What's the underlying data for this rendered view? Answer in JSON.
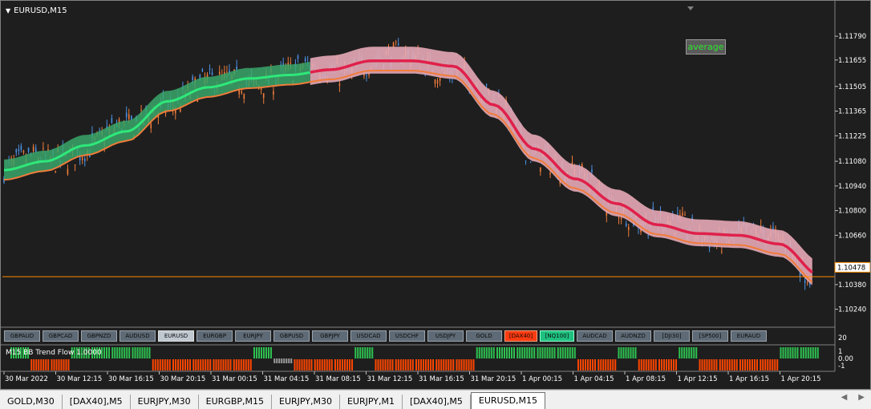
{
  "chart_title": "EURUSD,M15",
  "average_button": "average",
  "indicator_label": "M15  BB Trend Flow  1.0000",
  "indicator_scale": [
    "20",
    "1",
    "0.00",
    "-1"
  ],
  "current_price": "1.10478",
  "y_axis_ticks": [
    "1.11790",
    "1.11655",
    "1.11505",
    "1.11365",
    "1.11225",
    "1.11080",
    "1.10940",
    "1.10800",
    "1.10660",
    "1.10380",
    "1.10240"
  ],
  "x_axis_ticks": [
    "30 Mar 2022",
    "30 Mar 12:15",
    "30 Mar 16:15",
    "30 Mar 20:15",
    "31 Mar 00:15",
    "31 Mar 04:15",
    "31 Mar 08:15",
    "31 Mar 12:15",
    "31 Mar 16:15",
    "31 Mar 20:15",
    "1 Apr 00:15",
    "1 Apr 04:15",
    "1 Apr 08:15",
    "1 Apr 12:15",
    "1 Apr 16:15",
    "1 Apr 20:15"
  ],
  "symbol_buttons": [
    {
      "label": "GBPAUD",
      "state": "normal"
    },
    {
      "label": "GBPCAD",
      "state": "normal"
    },
    {
      "label": "GBPNZD",
      "state": "normal"
    },
    {
      "label": "AUDUSD",
      "state": "normal"
    },
    {
      "label": "EURUSD",
      "state": "active"
    },
    {
      "label": "EURGBP",
      "state": "normal"
    },
    {
      "label": "EURJPY",
      "state": "normal"
    },
    {
      "label": "GBPUSD",
      "state": "normal"
    },
    {
      "label": "GBPJPY",
      "state": "normal"
    },
    {
      "label": "USDCAD",
      "state": "normal"
    },
    {
      "label": "USDCHF",
      "state": "normal"
    },
    {
      "label": "USDJPY",
      "state": "normal"
    },
    {
      "label": "GOLD",
      "state": "normal"
    },
    {
      "label": "[DAX40]",
      "state": "red"
    },
    {
      "label": "[NQ100]",
      "state": "green"
    },
    {
      "label": "AUDCAD",
      "state": "normal"
    },
    {
      "label": "AUDNZD",
      "state": "normal"
    },
    {
      "label": "[DJI30]",
      "state": "normal"
    },
    {
      "label": "[SP500]",
      "state": "normal"
    },
    {
      "label": "EURAUD",
      "state": "normal"
    }
  ],
  "tabs": [
    {
      "label": "GOLD,M30",
      "active": false
    },
    {
      "label": "[DAX40],M5",
      "active": false
    },
    {
      "label": "EURJPY,M30",
      "active": false
    },
    {
      "label": "EURGBP,M15",
      "active": false
    },
    {
      "label": "EURJPY,M30",
      "active": false
    },
    {
      "label": "EURJPY,M1",
      "active": false
    },
    {
      "label": "[DAX40],M5",
      "active": false
    },
    {
      "label": "EURUSD,M15",
      "active": true
    }
  ],
  "colors": {
    "background": "#1e1e1e",
    "bull_candle": "#4a90e2",
    "bear_candle": "#f07c3a",
    "trend_up": "#2ee87a",
    "trend_down": "#e0204a",
    "band_fill_up": "#3aa66a",
    "band_fill_down": "#e6a8b6",
    "signal_green": "#2ec050",
    "signal_red": "#ff4500",
    "price_line": "#ff8c00"
  },
  "chart_data": {
    "type": "candlestick",
    "symbol": "EURUSD",
    "timeframe": "M15",
    "ylim": [
      1.1017,
      1.119
    ],
    "trend_center": [
      {
        "x": 0,
        "y": 1.1103
      },
      {
        "x": 5,
        "y": 1.1108
      },
      {
        "x": 10,
        "y": 1.1117
      },
      {
        "x": 15,
        "y": 1.1125
      },
      {
        "x": 20,
        "y": 1.1142
      },
      {
        "x": 25,
        "y": 1.115
      },
      {
        "x": 30,
        "y": 1.1155
      },
      {
        "x": 35,
        "y": 1.1157
      },
      {
        "x": 40,
        "y": 1.116
      },
      {
        "x": 45,
        "y": 1.1165
      },
      {
        "x": 50,
        "y": 1.1165
      },
      {
        "x": 55,
        "y": 1.1162
      },
      {
        "x": 60,
        "y": 1.114
      },
      {
        "x": 65,
        "y": 1.1115
      },
      {
        "x": 70,
        "y": 1.1098
      },
      {
        "x": 75,
        "y": 1.1084
      },
      {
        "x": 80,
        "y": 1.1072
      },
      {
        "x": 85,
        "y": 1.1067
      },
      {
        "x": 90,
        "y": 1.1066
      },
      {
        "x": 95,
        "y": 1.1061
      },
      {
        "x": 100,
        "y": 1.1043
      }
    ],
    "trend_state": [
      "up",
      "up",
      "up",
      "up",
      "up",
      "up",
      "up",
      "up",
      "up",
      "up",
      "down",
      "down",
      "down",
      "down",
      "down",
      "down",
      "down",
      "down",
      "down",
      "down",
      "down"
    ],
    "signal_bars": [
      "+",
      "-",
      "-",
      "+",
      "+",
      "+",
      "+",
      "-",
      "-",
      "-",
      "-",
      "-",
      "+",
      "0",
      "-",
      "-",
      "-",
      "+",
      "-",
      "-",
      "-",
      "-",
      "-",
      "+",
      "+",
      "+",
      "+",
      "+",
      "-",
      "-",
      "+",
      "-",
      "-",
      "+",
      "-",
      "-",
      "-",
      "-",
      "+",
      "+"
    ]
  }
}
